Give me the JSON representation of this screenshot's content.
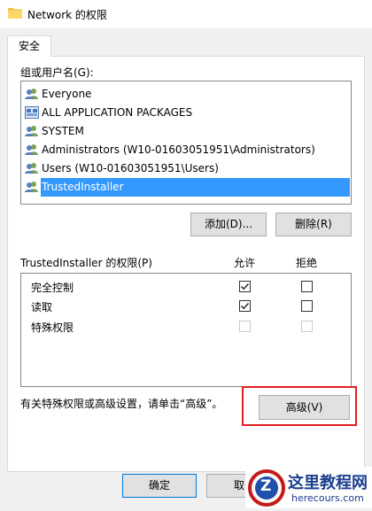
{
  "window": {
    "title": "Network 的权限",
    "icon": "folder-icon"
  },
  "tabs": [
    {
      "label": "安全"
    }
  ],
  "groups": {
    "label": "组或用户名(G):",
    "items": [
      {
        "label": "Everyone",
        "icon": "users-icon"
      },
      {
        "label": "ALL APPLICATION PACKAGES",
        "icon": "app-packages-icon"
      },
      {
        "label": "SYSTEM",
        "icon": "users-icon"
      },
      {
        "label": "Administrators (W10-01603051951\\Administrators)",
        "icon": "users-icon"
      },
      {
        "label": "Users (W10-01603051951\\Users)",
        "icon": "users-icon"
      },
      {
        "label": "TrustedInstaller",
        "icon": "users-icon",
        "selected": true
      }
    ],
    "add_button": "添加(D)...",
    "remove_button": "删除(R)"
  },
  "permissions": {
    "header": "TrustedInstaller 的权限(P)",
    "allow_header": "允许",
    "deny_header": "拒绝",
    "rows": [
      {
        "name": "完全控制",
        "allow": true,
        "deny": false,
        "enabled": true
      },
      {
        "name": "读取",
        "allow": true,
        "deny": false,
        "enabled": true
      },
      {
        "name": "特殊权限",
        "allow": false,
        "deny": false,
        "enabled": false
      }
    ]
  },
  "advanced": {
    "hint": "有关特殊权限或高级设置，请单击“高级”。",
    "button": "高级(V)"
  },
  "footer": {
    "ok": "确定",
    "cancel": "取"
  },
  "watermark": {
    "text": "这里教程网",
    "url": "herecours.com",
    "letter": "Z"
  },
  "colors": {
    "selection": "#3399ff",
    "highlight_border": "#e02020"
  }
}
